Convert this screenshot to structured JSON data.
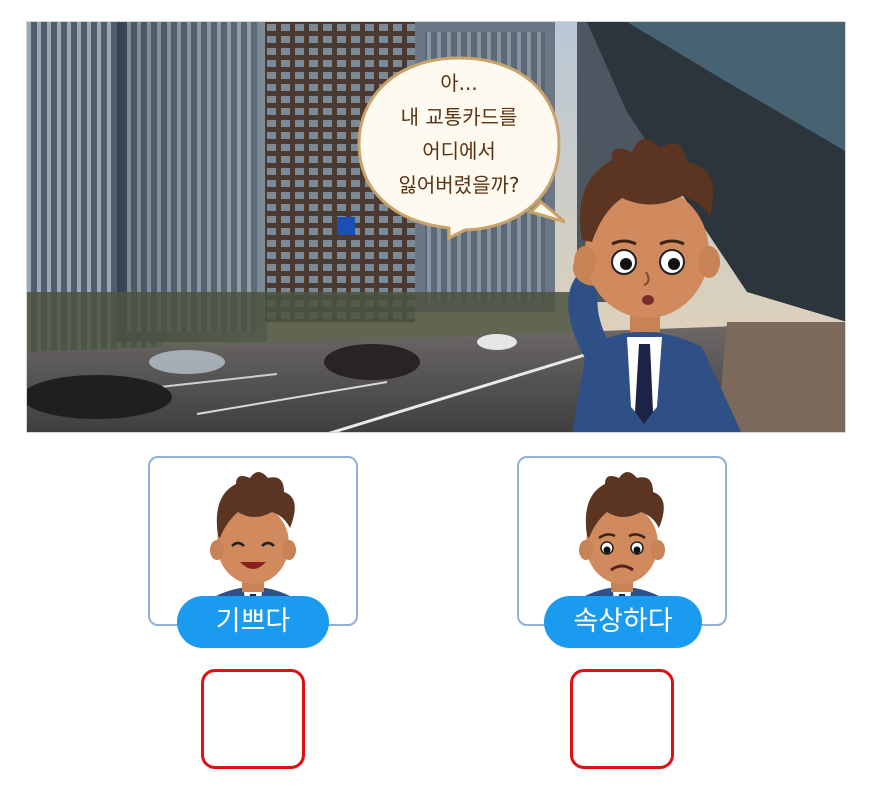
{
  "scene": {
    "speech_lines": [
      "아...",
      "내 교통카드를",
      "어디에서",
      "잃어버렸을까?"
    ]
  },
  "choices": [
    {
      "label": "기쁘다",
      "face": "happy-face-icon"
    },
    {
      "label": "속상하다",
      "face": "sad-face-icon"
    }
  ],
  "colors": {
    "card_border": "#8fb0d9",
    "pill": "#1a9bf0",
    "answer_border": "#e01010",
    "speech_text": "#5a3315"
  }
}
